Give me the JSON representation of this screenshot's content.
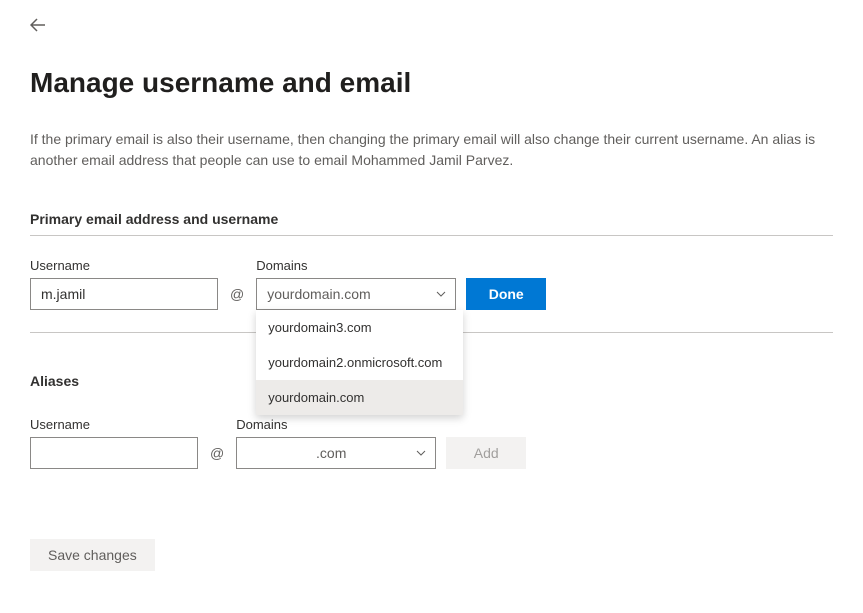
{
  "header": {
    "title": "Manage username and email",
    "description": "If the primary email is also their username, then changing the primary email will also change their current username. An alias is another email address that people can use to email Mohammed Jamil Parvez."
  },
  "primary_section": {
    "heading": "Primary email address and username",
    "username_label": "Username",
    "username_value": "m.jamil",
    "at_symbol": "@",
    "domains_label": "Domains",
    "domain_selected": "yourdomain.com",
    "done_label": "Done",
    "dropdown_options": [
      {
        "label": "yourdomain3.com",
        "selected": false
      },
      {
        "label": "yourdomain2.onmicrosoft.com",
        "selected": false
      },
      {
        "label": "yourdomain.com",
        "selected": true
      }
    ]
  },
  "aliases_section": {
    "heading": "Aliases",
    "username_label": "Username",
    "username_value": "",
    "at_symbol": "@",
    "domains_label": "Domains",
    "domain_text": ".com",
    "add_label": "Add"
  },
  "footer": {
    "save_label": "Save changes"
  }
}
